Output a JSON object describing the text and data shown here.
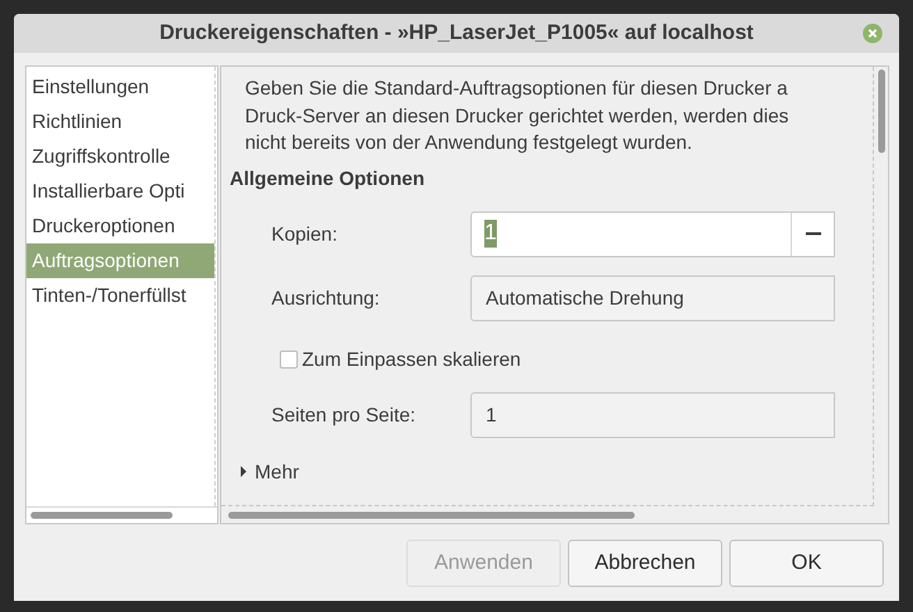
{
  "window": {
    "title": "Druckereigenschaften - »HP_LaserJet_P1005« auf localhost"
  },
  "sidebar": {
    "items": [
      {
        "label": "Einstellungen",
        "selected": false
      },
      {
        "label": "Richtlinien",
        "selected": false
      },
      {
        "label": "Zugriffskontrolle",
        "selected": false
      },
      {
        "label": "Installierbare Opti",
        "selected": false
      },
      {
        "label": "Druckeroptionen",
        "selected": false
      },
      {
        "label": "Auftragsoptionen",
        "selected": true
      },
      {
        "label": "Tinten-/Tonerfüllst",
        "selected": false
      }
    ]
  },
  "description": [
    "Geben Sie die Standard-Auftragsoptionen für diesen Drucker a",
    "Druck-Server an diesen Drucker gerichtet werden, werden dies",
    "nicht bereits von der Anwendung festgelegt wurden."
  ],
  "section_title": "Allgemeine Optionen",
  "options": [
    {
      "kind": "spin",
      "label": "Kopien:",
      "value": "1",
      "value_selected": true
    },
    {
      "kind": "combo",
      "label": "Ausrichtung:",
      "value": "Automatische Drehung"
    },
    {
      "kind": "checkbox",
      "label": "Zum Einpassen skalieren",
      "checked": false
    },
    {
      "kind": "combo",
      "label": "Seiten pro Seite:",
      "value": "1"
    }
  ],
  "expander": {
    "label": "Mehr",
    "expanded": false
  },
  "buttons": [
    {
      "label": "Anwenden",
      "disabled": true
    },
    {
      "label": "Abbrechen",
      "disabled": false
    },
    {
      "label": "OK",
      "disabled": false
    }
  ]
}
